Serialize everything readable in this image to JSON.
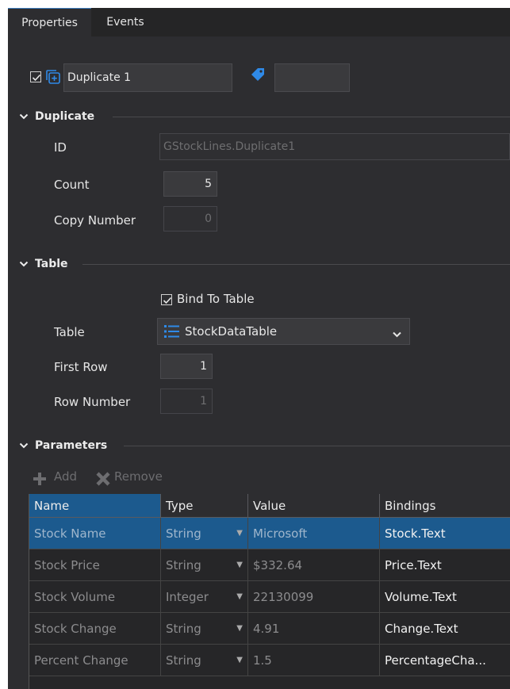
{
  "tabs": {
    "properties": "Properties",
    "events": "Events"
  },
  "header": {
    "name_value": "Duplicate 1",
    "tag_value": ""
  },
  "duplicate": {
    "title": "Duplicate",
    "id_label": "ID",
    "id_value": "GStockLines.Duplicate1",
    "count_label": "Count",
    "count_value": "5",
    "copy_label": "Copy Number",
    "copy_value": "0"
  },
  "table_section": {
    "title": "Table",
    "bind_label": "Bind To Table",
    "table_label": "Table",
    "table_value": "StockDataTable",
    "first_row_label": "First Row",
    "first_row_value": "1",
    "row_number_label": "Row Number",
    "row_number_value": "1"
  },
  "parameters": {
    "title": "Parameters",
    "add_label": "Add",
    "remove_label": "Remove",
    "columns": [
      "Name",
      "Type",
      "Value",
      "Bindings"
    ],
    "rows": [
      {
        "name": "Stock Name",
        "type": "String",
        "value": "Microsoft",
        "binding": "Stock.Text"
      },
      {
        "name": "Stock Price",
        "type": "String",
        "value": "$332.64",
        "binding": "Price.Text"
      },
      {
        "name": "Stock Volume",
        "type": "Integer",
        "value": "22130099",
        "binding": "Volume.Text"
      },
      {
        "name": "Stock Change",
        "type": "String",
        "value": "4.91",
        "binding": "Change.Text"
      },
      {
        "name": "Percent Change",
        "type": "String",
        "value": "1.5",
        "binding": "PercentageCha..."
      }
    ]
  },
  "colors": {
    "panel": "#2d2d30",
    "selection": "#1c5a8e",
    "accent": "#2f8ae8"
  }
}
